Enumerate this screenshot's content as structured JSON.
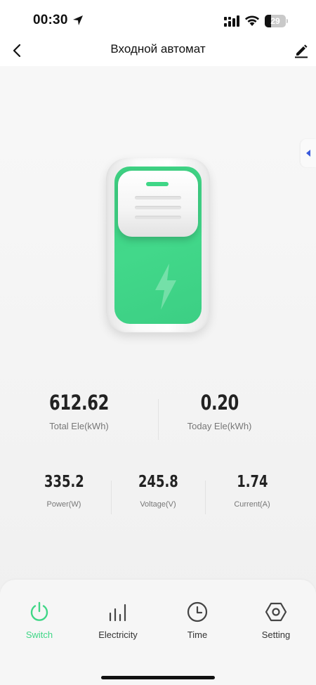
{
  "status_bar": {
    "time": "00:30",
    "battery_level": "29",
    "battery_fraction": 0.29
  },
  "nav": {
    "title": "Входной автомат",
    "back_icon": "chevron-left-icon",
    "edit_icon": "pencil-icon"
  },
  "device": {
    "state": "on",
    "accent_color": "#3fd686"
  },
  "energy": {
    "total": {
      "value": "612.62",
      "label": "Total Ele(kWh)"
    },
    "today": {
      "value": "0.20",
      "label": "Today Ele(kWh)"
    }
  },
  "metrics": [
    {
      "value": "335.2",
      "label": "Power(W)"
    },
    {
      "value": "245.8",
      "label": "Voltage(V)"
    },
    {
      "value": "1.74",
      "label": "Current(A)"
    }
  ],
  "tabs": [
    {
      "label": "Switch",
      "icon": "power-icon",
      "active": true
    },
    {
      "label": "Electricity",
      "icon": "bar-chart-icon",
      "active": false
    },
    {
      "label": "Time",
      "icon": "clock-icon",
      "active": false
    },
    {
      "label": "Setting",
      "icon": "hexagon-settings-icon",
      "active": false
    }
  ]
}
